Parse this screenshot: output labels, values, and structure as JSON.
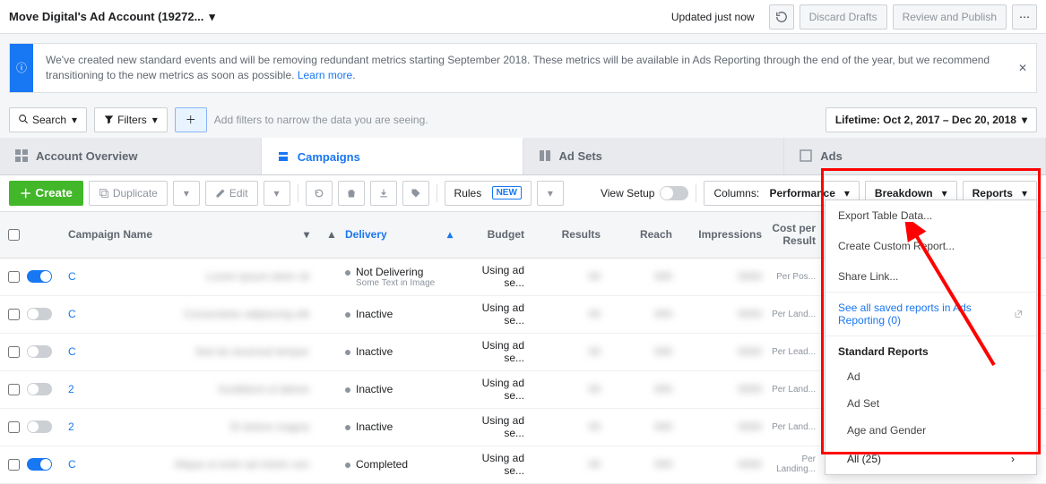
{
  "topbar": {
    "account_name": "Move Digital's Ad Account (19272...",
    "updated": "Updated just now",
    "discard": "Discard Drafts",
    "review": "Review and Publish"
  },
  "banner": {
    "text": "We've created new standard events and will be removing redundant metrics starting September 2018. These metrics will be available in Ads Reporting through the end of the year, but we recommend transitioning to the new metrics as soon as possible.",
    "learn_more": "Learn more"
  },
  "filterbar": {
    "search": "Search",
    "filters": "Filters",
    "placeholder": "Add filters to narrow the data you are seeing.",
    "date_range": "Lifetime: Oct 2, 2017 – Dec 20, 2018"
  },
  "tabs": {
    "overview": "Account Overview",
    "campaigns": "Campaigns",
    "adsets": "Ad Sets",
    "ads": "Ads"
  },
  "toolbar": {
    "create": "Create",
    "duplicate": "Duplicate",
    "edit": "Edit",
    "rules": "Rules",
    "new": "NEW",
    "view_setup": "View Setup",
    "columns": "Columns:",
    "columns_val": "Performance",
    "breakdown": "Breakdown",
    "reports": "Reports"
  },
  "headers": {
    "name": "Campaign Name",
    "delivery": "Delivery",
    "budget": "Budget",
    "results": "Results",
    "reach": "Reach",
    "impressions": "Impressions",
    "cpr": "Cost per Result"
  },
  "rows": [
    {
      "on": true,
      "name": "C",
      "name_blur": "Lorem ipsum dolor sit",
      "delivery": "Not Delivering",
      "sub": "Some Text in Image",
      "budget": "Using ad se...",
      "cpr_sub": "Per Pos..."
    },
    {
      "on": false,
      "name": "C",
      "name_blur": "Consectetur adipiscing elit",
      "delivery": "Inactive",
      "sub": "",
      "budget": "Using ad se...",
      "cpr_sub": "Per Land..."
    },
    {
      "on": false,
      "name": "C",
      "name_blur": "Sed do eiusmod tempor",
      "delivery": "Inactive",
      "sub": "",
      "budget": "Using ad se...",
      "cpr_sub": "Per Lead..."
    },
    {
      "on": false,
      "name": "2",
      "name_blur": "Incididunt ut labore",
      "delivery": "Inactive",
      "sub": "",
      "budget": "Using ad se...",
      "cpr_sub": "Per Land..."
    },
    {
      "on": false,
      "name": "2",
      "name_blur": "Et dolore magna",
      "delivery": "Inactive",
      "sub": "",
      "budget": "Using ad se...",
      "cpr_sub": "Per Land..."
    },
    {
      "on": true,
      "name": "C",
      "name_blur": "Aliqua ut enim ad minim ven",
      "delivery": "Completed",
      "sub": "",
      "budget": "Using ad se...",
      "cpr_sub": "Per Landing..."
    }
  ],
  "dropdown": {
    "export": "Export Table Data...",
    "custom": "Create Custom Report...",
    "share": "Share Link...",
    "see_all": "See all saved reports in Ads Reporting (0)",
    "std_head": "Standard Reports",
    "std_items": [
      "Ad",
      "Ad Set",
      "Age and Gender"
    ],
    "all": "All (25)"
  }
}
